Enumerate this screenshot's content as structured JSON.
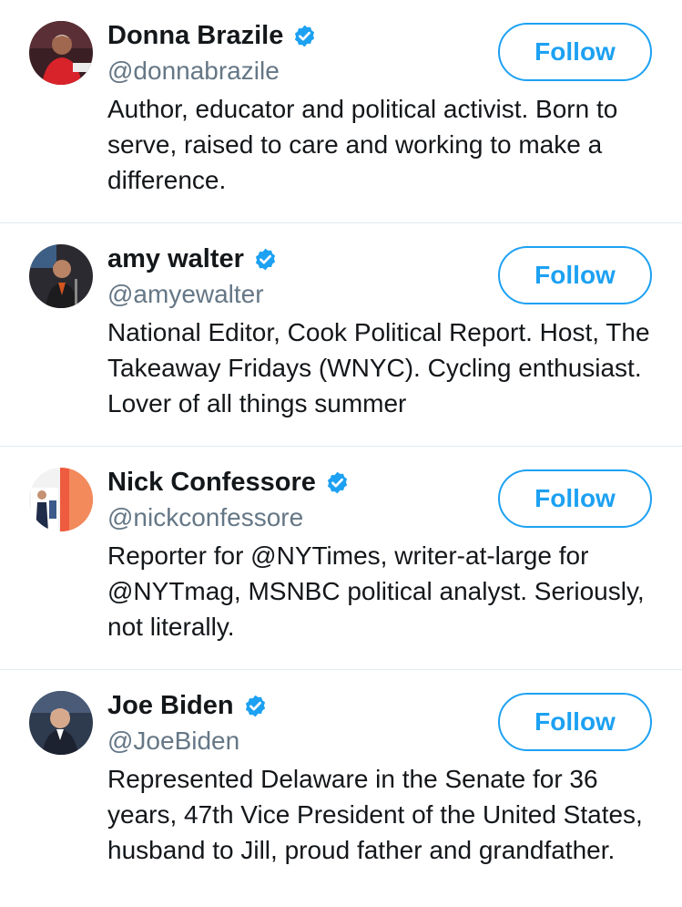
{
  "icons": {
    "verified": "verified-badge-icon",
    "accent": "#1da1f2",
    "handle_color": "#657786"
  },
  "users": [
    {
      "name": "Donna Brazile",
      "handle": "@donnabrazile",
      "bio": "Author, educator and political activist. Born to serve, raised to care and working to make a difference.",
      "follow_label": "Follow"
    },
    {
      "name": "amy walter",
      "handle": "@amyewalter",
      "bio": "National Editor, Cook Political Report. Host, The Takeaway Fridays (WNYC). Cycling enthusiast. Lover of all things summer",
      "follow_label": "Follow"
    },
    {
      "name": "Nick Confessore",
      "handle": "@nickconfessore",
      "bio": "Reporter for @NYTimes, writer-at-large for @NYTmag, MSNBC political analyst. Seriously, not literally.",
      "follow_label": "Follow"
    },
    {
      "name": "Joe Biden",
      "handle": "@JoeBiden",
      "bio": "Represented Delaware in the Senate for 36 years, 47th Vice President of the United States, husband to Jill, proud father and grandfather.",
      "follow_label": "Follow"
    }
  ]
}
